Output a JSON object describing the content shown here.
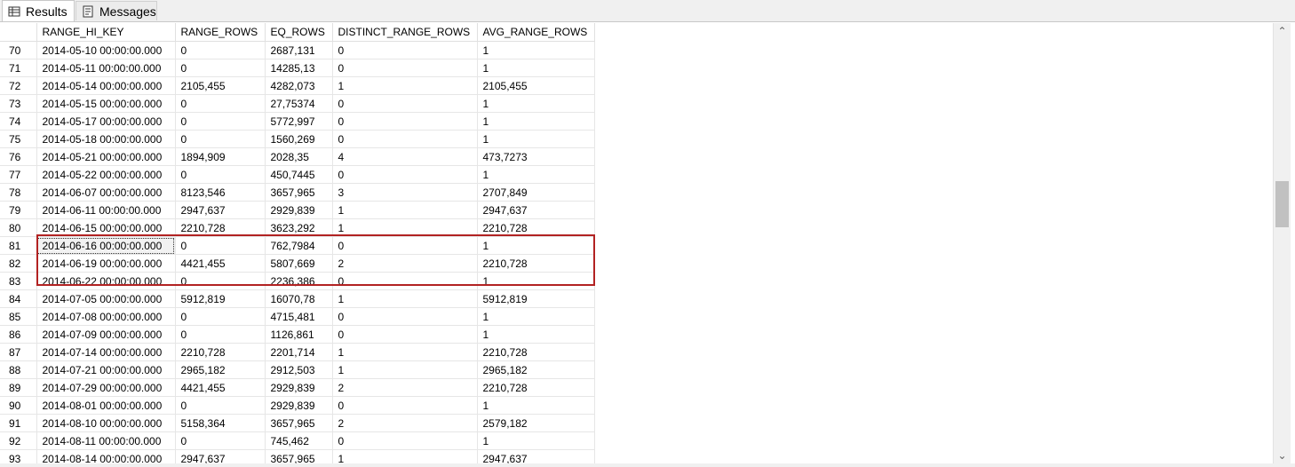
{
  "tabs": [
    {
      "label": "Results",
      "icon": "grid-icon"
    },
    {
      "label": "Messages",
      "icon": "messages-icon"
    }
  ],
  "columns": [
    "RANGE_HI_KEY",
    "RANGE_ROWS",
    "EQ_ROWS",
    "DISTINCT_RANGE_ROWS",
    "AVG_RANGE_ROWS"
  ],
  "rows": [
    [
      "70",
      "2014-05-10 00:00:00.000",
      "0",
      "2687,131",
      "0",
      "1"
    ],
    [
      "71",
      "2014-05-11 00:00:00.000",
      "0",
      "14285,13",
      "0",
      "1"
    ],
    [
      "72",
      "2014-05-14 00:00:00.000",
      "2105,455",
      "4282,073",
      "1",
      "2105,455"
    ],
    [
      "73",
      "2014-05-15 00:00:00.000",
      "0",
      "27,75374",
      "0",
      "1"
    ],
    [
      "74",
      "2014-05-17 00:00:00.000",
      "0",
      "5772,997",
      "0",
      "1"
    ],
    [
      "75",
      "2014-05-18 00:00:00.000",
      "0",
      "1560,269",
      "0",
      "1"
    ],
    [
      "76",
      "2014-05-21 00:00:00.000",
      "1894,909",
      "2028,35",
      "4",
      "473,7273"
    ],
    [
      "77",
      "2014-05-22 00:00:00.000",
      "0",
      "450,7445",
      "0",
      "1"
    ],
    [
      "78",
      "2014-06-07 00:00:00.000",
      "8123,546",
      "3657,965",
      "3",
      "2707,849"
    ],
    [
      "79",
      "2014-06-11 00:00:00.000",
      "2947,637",
      "2929,839",
      "1",
      "2947,637"
    ],
    [
      "80",
      "2014-06-15 00:00:00.000",
      "2210,728",
      "3623,292",
      "1",
      "2210,728"
    ],
    [
      "81",
      "2014-06-16 00:00:00.000",
      "0",
      "762,7984",
      "0",
      "1"
    ],
    [
      "82",
      "2014-06-19 00:00:00.000",
      "4421,455",
      "5807,669",
      "2",
      "2210,728"
    ],
    [
      "83",
      "2014-06-22 00:00:00.000",
      "0",
      "2236,386",
      "0",
      "1"
    ],
    [
      "84",
      "2014-07-05 00:00:00.000",
      "5912,819",
      "16070,78",
      "1",
      "5912,819"
    ],
    [
      "85",
      "2014-07-08 00:00:00.000",
      "0",
      "4715,481",
      "0",
      "1"
    ],
    [
      "86",
      "2014-07-09 00:00:00.000",
      "0",
      "1126,861",
      "0",
      "1"
    ],
    [
      "87",
      "2014-07-14 00:00:00.000",
      "2210,728",
      "2201,714",
      "1",
      "2210,728"
    ],
    [
      "88",
      "2014-07-21 00:00:00.000",
      "2965,182",
      "2912,503",
      "1",
      "2965,182"
    ],
    [
      "89",
      "2014-07-29 00:00:00.000",
      "4421,455",
      "2929,839",
      "2",
      "2210,728"
    ],
    [
      "90",
      "2014-08-01 00:00:00.000",
      "0",
      "2929,839",
      "0",
      "1"
    ],
    [
      "91",
      "2014-08-10 00:00:00.000",
      "5158,364",
      "3657,965",
      "2",
      "2579,182"
    ],
    [
      "92",
      "2014-08-11 00:00:00.000",
      "0",
      "745,462",
      "0",
      "1"
    ],
    [
      "93",
      "2014-08-14 00:00:00.000",
      "2947,637",
      "3657,965",
      "1",
      "2947,637"
    ]
  ],
  "selected_row": "81",
  "highlighted_rows": [
    "81",
    "82",
    "83"
  ],
  "colors": {
    "highlight_border": "#b22222",
    "grid_line": "#e6e6e6",
    "tab_bg": "#f0f0f0"
  }
}
